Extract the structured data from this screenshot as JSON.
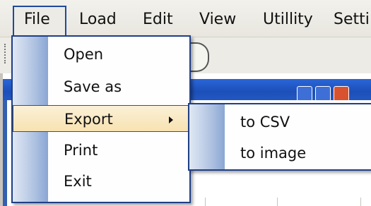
{
  "menubar": {
    "items": [
      {
        "label": "File",
        "open": true
      },
      {
        "label": "Load"
      },
      {
        "label": "Edit"
      },
      {
        "label": "View"
      },
      {
        "label": "Utillity"
      },
      {
        "label": "Setti"
      }
    ]
  },
  "file_menu": {
    "items": [
      {
        "label": "Open"
      },
      {
        "label": "Save as"
      },
      {
        "label": "Export",
        "has_submenu": true,
        "highlighted": true
      },
      {
        "label": "Print"
      },
      {
        "label": "Exit"
      }
    ]
  },
  "export_submenu": {
    "items": [
      {
        "label": "to CSV"
      },
      {
        "label": "to image"
      }
    ]
  },
  "colors": {
    "menu_border": "#1f3f86",
    "highlight": "#f7e2b1",
    "title_bar": "#2457c2"
  }
}
